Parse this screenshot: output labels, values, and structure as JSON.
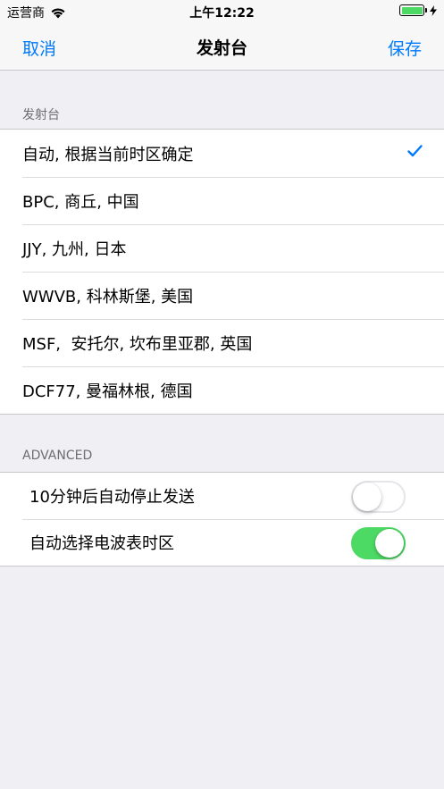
{
  "status_bar": {
    "carrier": "运营商",
    "time": "上午12:22",
    "battery_level": 1.0
  },
  "nav": {
    "cancel": "取消",
    "title": "发射台",
    "save": "保存"
  },
  "stations_section": {
    "header": "发射台",
    "items": [
      {
        "label": "自动, 根据当前时区确定",
        "selected": true
      },
      {
        "label": "BPC, 商丘, 中国",
        "selected": false
      },
      {
        "label": "JJY, 九州, 日本",
        "selected": false
      },
      {
        "label": "WWVB, 科林斯堡, 美国",
        "selected": false
      },
      {
        "label": "MSF,  安托尔, 坎布里亚郡, 英国",
        "selected": false
      },
      {
        "label": "DCF77, 曼福林根, 德国",
        "selected": false
      }
    ]
  },
  "advanced_section": {
    "header": "ADVANCED",
    "items": [
      {
        "label": "10分钟后自动停止发送",
        "on": false
      },
      {
        "label": "自动选择电波表时区",
        "on": true
      }
    ]
  },
  "colors": {
    "accent": "#007aff",
    "switch_on": "#4cd964",
    "background": "#efeff4"
  },
  "icons": {
    "wifi": "wifi-icon",
    "battery": "battery-icon",
    "charging": "bolt-icon",
    "selected": "check-icon"
  }
}
